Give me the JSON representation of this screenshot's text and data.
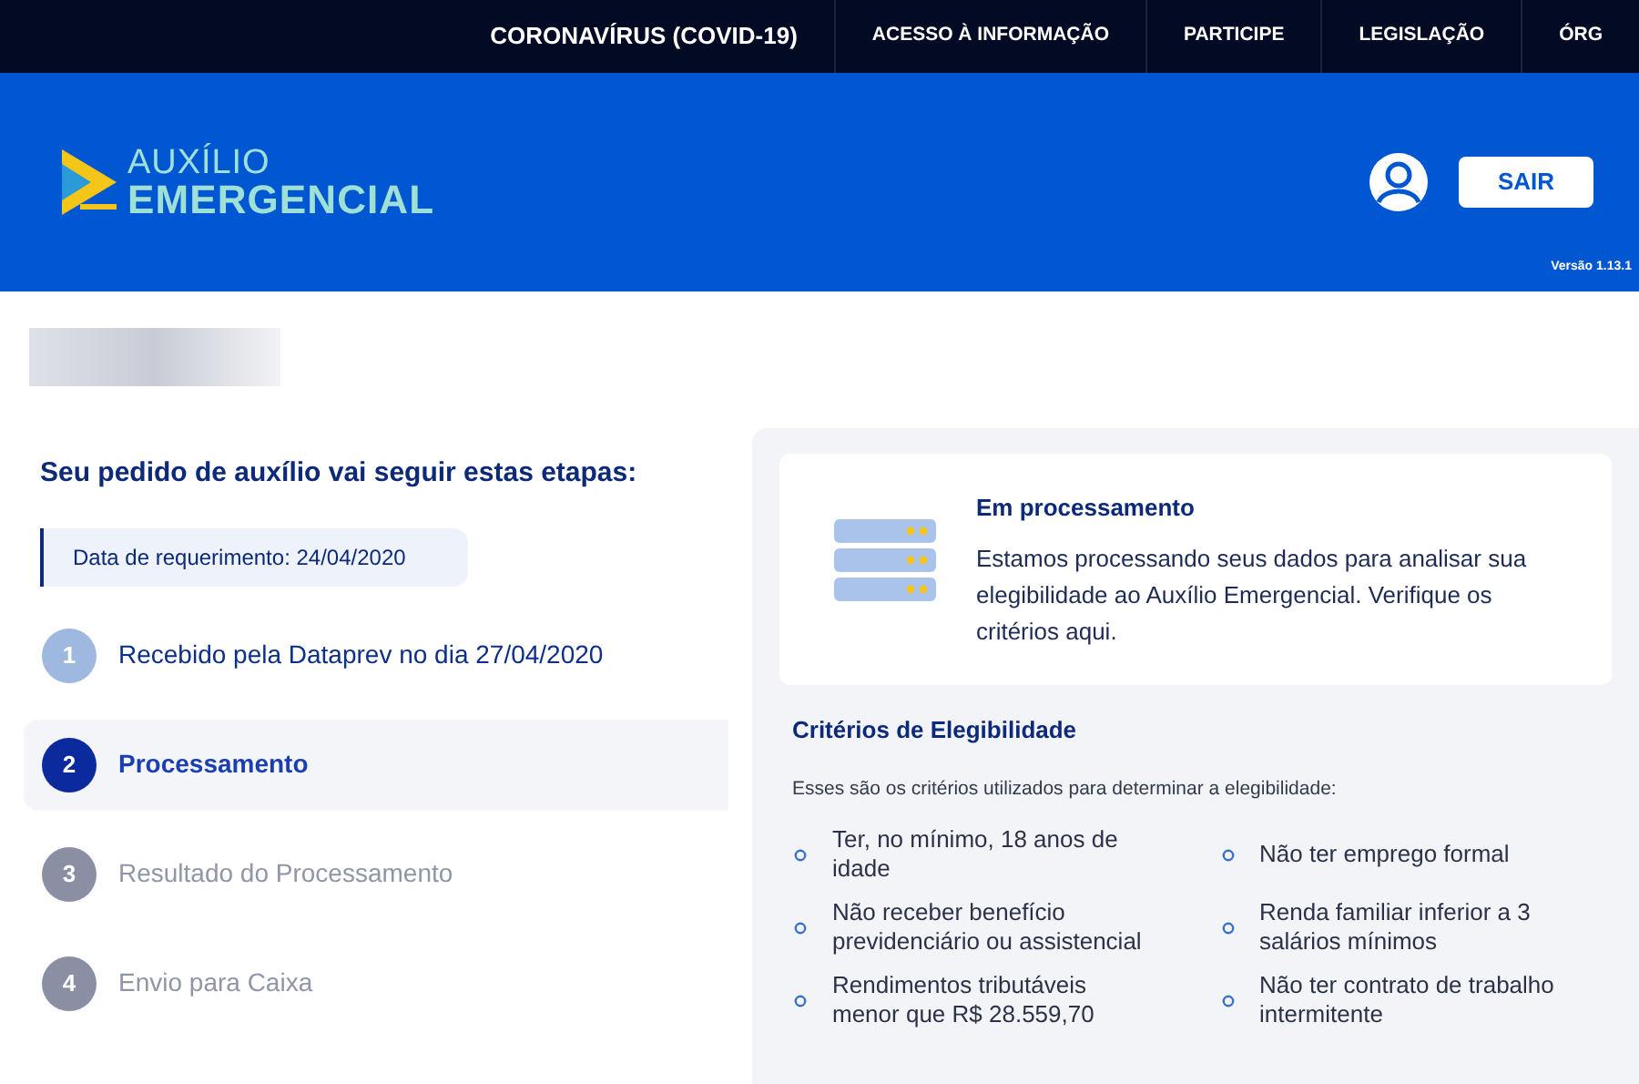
{
  "top_nav": {
    "items": [
      {
        "label": "CORONAVÍRUS (COVID-19)",
        "kind": "main"
      },
      {
        "label": "ACESSO À INFORMAÇÃO",
        "kind": "link"
      },
      {
        "label": "PARTICIPE",
        "kind": "link"
      },
      {
        "label": "LEGISLAÇÃO",
        "kind": "link"
      },
      {
        "label": "ÓRG",
        "kind": "link"
      }
    ]
  },
  "header": {
    "logo_top": "AUXÍLIO",
    "logo_bottom": "EMERGENCIAL",
    "logout": "SAIR",
    "version": "Versão 1.13.1"
  },
  "steps_panel": {
    "title": "Seu pedido de auxílio vai seguir estas etapas:",
    "request_date": "Data de requerimento: 24/04/2020",
    "steps": [
      {
        "number": "1",
        "label": "Recebido pela Dataprev no dia 27/04/2020",
        "done": true,
        "selected": false
      },
      {
        "number": "2",
        "label": "Processamento",
        "done": false,
        "selected": true
      },
      {
        "number": "3",
        "label": "Resultado do Processamento",
        "done": false,
        "selected": false
      },
      {
        "number": "4",
        "label": "Envio para Caixa",
        "done": false,
        "selected": false
      }
    ]
  },
  "status_card": {
    "title": "Em processamento",
    "text": "Estamos processando seus dados para analisar sua elegibilidade ao Auxílio Emergencial. Verifique os critérios aqui."
  },
  "criteria": {
    "title": "Critérios de Elegibilidade",
    "intro": "Esses são os critérios utilizados para determinar a elegibilidade:",
    "items": [
      "Ter, no mínimo, 18 anos de idade",
      "Não ter emprego formal",
      "Não receber benefício previdenciário ou assistencial",
      "Renda familiar inferior a 3 salários mínimos",
      "Rendimentos tributáveis menor que R$ 28.559,70",
      "Não ter contrato de trabalho intermitente"
    ]
  }
}
